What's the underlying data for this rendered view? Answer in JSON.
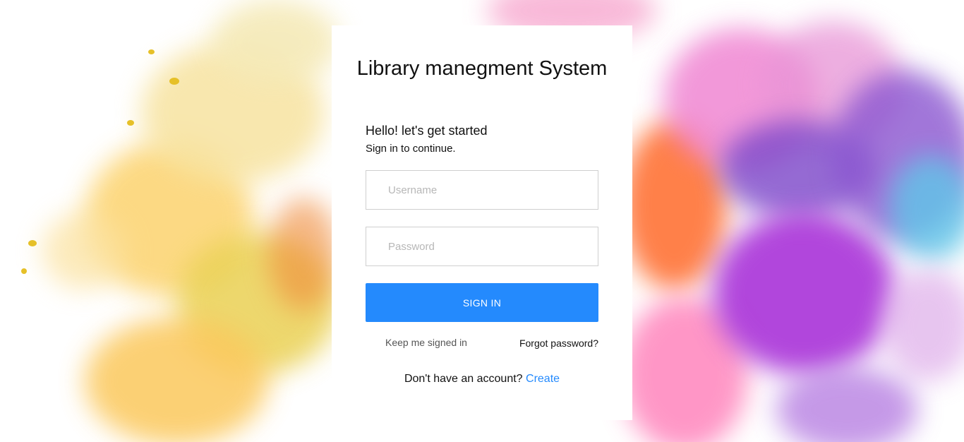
{
  "login": {
    "title": "Library manegment System",
    "greeting": "Hello! let's get started",
    "subtext": "Sign in to continue.",
    "username_placeholder": "Username",
    "username_value": "",
    "password_placeholder": "Password",
    "password_value": "",
    "signin_label": "SIGN IN",
    "keep_signed_label": "Keep me signed in",
    "forgot_label": "Forgot password?",
    "no_account_text": "Don't have an account?",
    "create_label": "Create"
  },
  "colors": {
    "accent": "#248afd",
    "card_bg": "#ffffff",
    "input_border": "#cfcfcf"
  }
}
